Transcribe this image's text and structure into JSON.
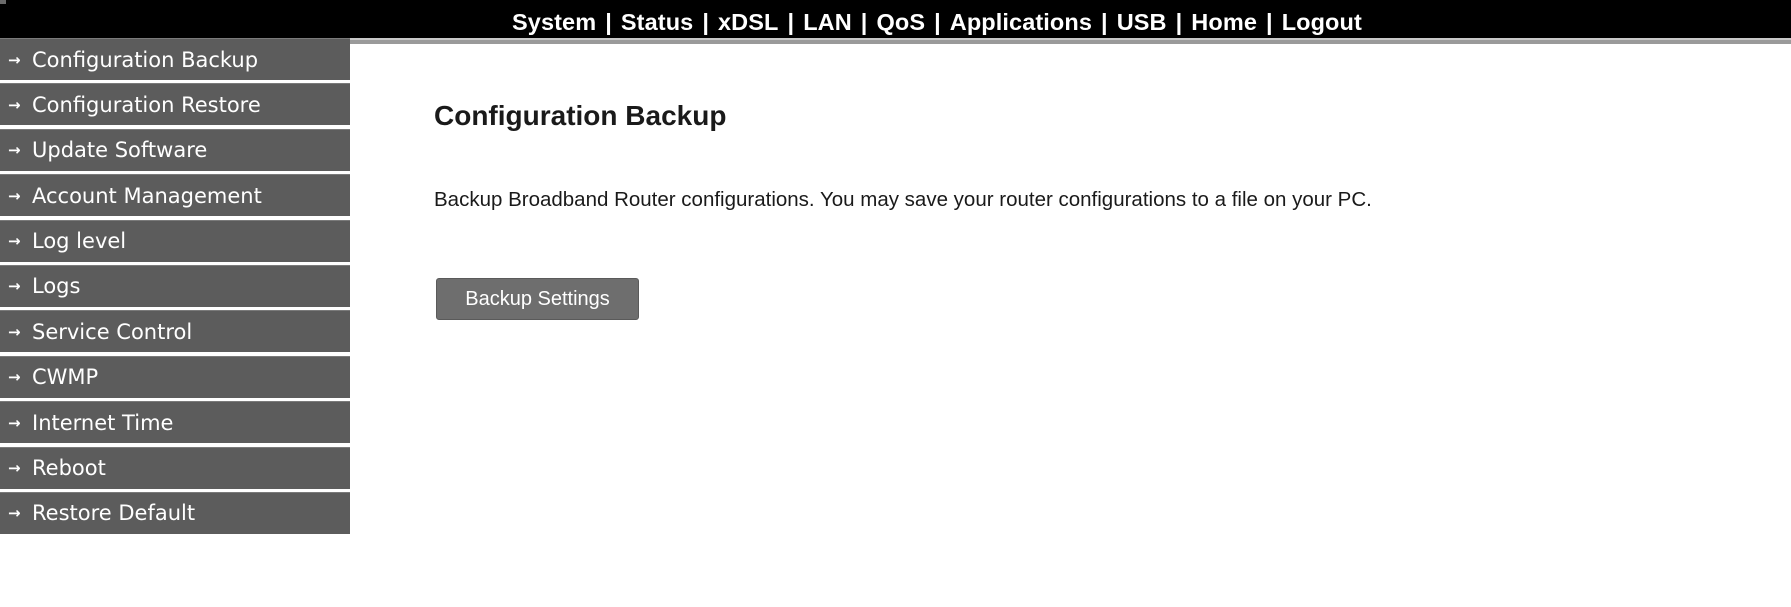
{
  "topnav": {
    "items": [
      "System",
      "Status",
      "xDSL",
      "LAN",
      "QoS",
      "Applications",
      "USB",
      "Home",
      "Logout"
    ],
    "separator": "|"
  },
  "sidebar": {
    "arrow": "→",
    "items": [
      {
        "label": "Configuration Backup"
      },
      {
        "label": "Configuration Restore"
      },
      {
        "label": "Update Software"
      },
      {
        "label": "Account Management"
      },
      {
        "label": "Log level"
      },
      {
        "label": "Logs"
      },
      {
        "label": "Service Control"
      },
      {
        "label": "CWMP"
      },
      {
        "label": "Internet Time"
      },
      {
        "label": "Reboot"
      },
      {
        "label": "Restore Default"
      }
    ]
  },
  "main": {
    "title": "Configuration Backup",
    "description": "Backup Broadband Router configurations. You may save your router configurations to a file on your PC.",
    "backup_button_label": "Backup Settings"
  },
  "colors": {
    "topbar_bg": "#000000",
    "sidebar_item_bg": "#5c5c5c",
    "button_bg": "#6e6e6e",
    "text": "#1a1a1a"
  }
}
